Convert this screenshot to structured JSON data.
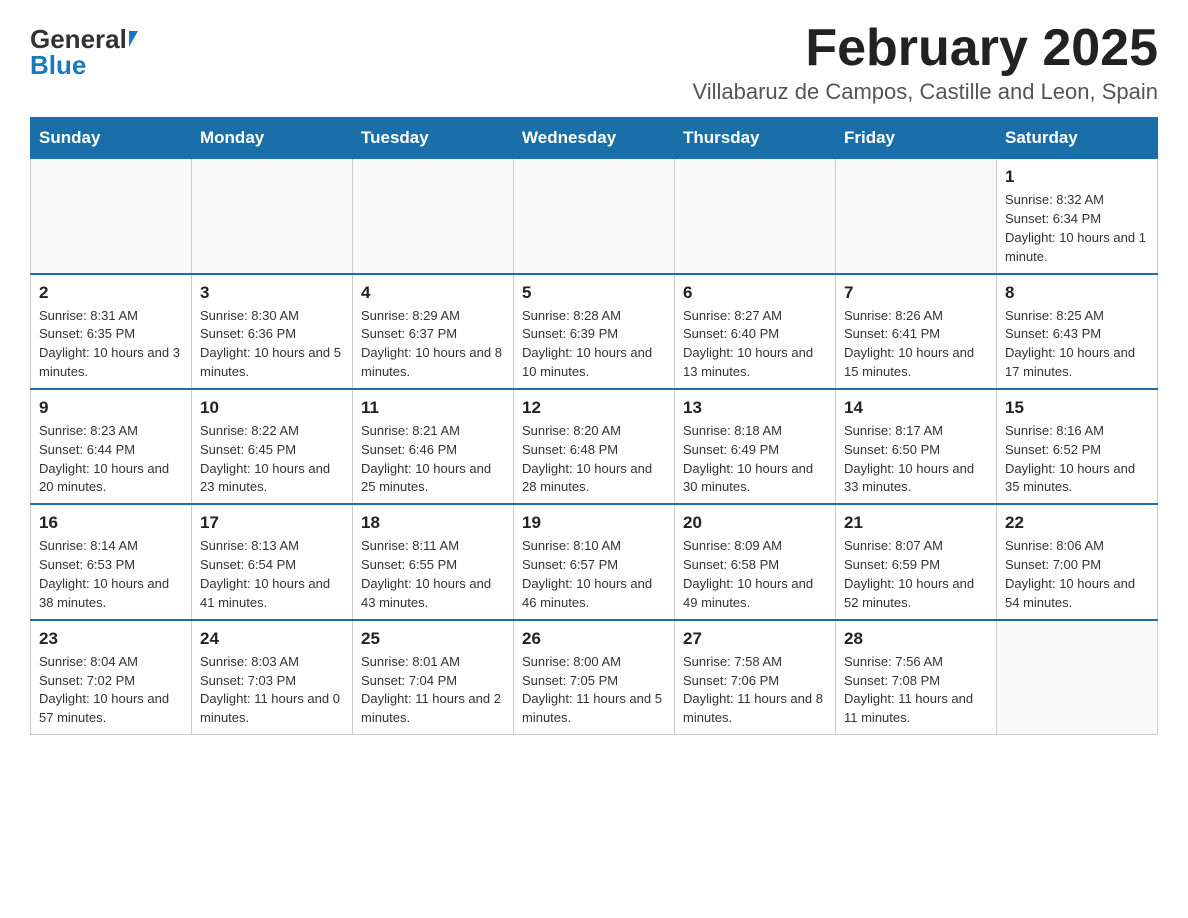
{
  "header": {
    "logo_general": "General",
    "logo_blue": "Blue",
    "month_title": "February 2025",
    "location": "Villabaruz de Campos, Castille and Leon, Spain"
  },
  "days_of_week": [
    "Sunday",
    "Monday",
    "Tuesday",
    "Wednesday",
    "Thursday",
    "Friday",
    "Saturday"
  ],
  "weeks": [
    {
      "days": [
        {
          "num": "",
          "info": ""
        },
        {
          "num": "",
          "info": ""
        },
        {
          "num": "",
          "info": ""
        },
        {
          "num": "",
          "info": ""
        },
        {
          "num": "",
          "info": ""
        },
        {
          "num": "",
          "info": ""
        },
        {
          "num": "1",
          "info": "Sunrise: 8:32 AM\nSunset: 6:34 PM\nDaylight: 10 hours and 1 minute."
        }
      ]
    },
    {
      "days": [
        {
          "num": "2",
          "info": "Sunrise: 8:31 AM\nSunset: 6:35 PM\nDaylight: 10 hours and 3 minutes."
        },
        {
          "num": "3",
          "info": "Sunrise: 8:30 AM\nSunset: 6:36 PM\nDaylight: 10 hours and 5 minutes."
        },
        {
          "num": "4",
          "info": "Sunrise: 8:29 AM\nSunset: 6:37 PM\nDaylight: 10 hours and 8 minutes."
        },
        {
          "num": "5",
          "info": "Sunrise: 8:28 AM\nSunset: 6:39 PM\nDaylight: 10 hours and 10 minutes."
        },
        {
          "num": "6",
          "info": "Sunrise: 8:27 AM\nSunset: 6:40 PM\nDaylight: 10 hours and 13 minutes."
        },
        {
          "num": "7",
          "info": "Sunrise: 8:26 AM\nSunset: 6:41 PM\nDaylight: 10 hours and 15 minutes."
        },
        {
          "num": "8",
          "info": "Sunrise: 8:25 AM\nSunset: 6:43 PM\nDaylight: 10 hours and 17 minutes."
        }
      ]
    },
    {
      "days": [
        {
          "num": "9",
          "info": "Sunrise: 8:23 AM\nSunset: 6:44 PM\nDaylight: 10 hours and 20 minutes."
        },
        {
          "num": "10",
          "info": "Sunrise: 8:22 AM\nSunset: 6:45 PM\nDaylight: 10 hours and 23 minutes."
        },
        {
          "num": "11",
          "info": "Sunrise: 8:21 AM\nSunset: 6:46 PM\nDaylight: 10 hours and 25 minutes."
        },
        {
          "num": "12",
          "info": "Sunrise: 8:20 AM\nSunset: 6:48 PM\nDaylight: 10 hours and 28 minutes."
        },
        {
          "num": "13",
          "info": "Sunrise: 8:18 AM\nSunset: 6:49 PM\nDaylight: 10 hours and 30 minutes."
        },
        {
          "num": "14",
          "info": "Sunrise: 8:17 AM\nSunset: 6:50 PM\nDaylight: 10 hours and 33 minutes."
        },
        {
          "num": "15",
          "info": "Sunrise: 8:16 AM\nSunset: 6:52 PM\nDaylight: 10 hours and 35 minutes."
        }
      ]
    },
    {
      "days": [
        {
          "num": "16",
          "info": "Sunrise: 8:14 AM\nSunset: 6:53 PM\nDaylight: 10 hours and 38 minutes."
        },
        {
          "num": "17",
          "info": "Sunrise: 8:13 AM\nSunset: 6:54 PM\nDaylight: 10 hours and 41 minutes."
        },
        {
          "num": "18",
          "info": "Sunrise: 8:11 AM\nSunset: 6:55 PM\nDaylight: 10 hours and 43 minutes."
        },
        {
          "num": "19",
          "info": "Sunrise: 8:10 AM\nSunset: 6:57 PM\nDaylight: 10 hours and 46 minutes."
        },
        {
          "num": "20",
          "info": "Sunrise: 8:09 AM\nSunset: 6:58 PM\nDaylight: 10 hours and 49 minutes."
        },
        {
          "num": "21",
          "info": "Sunrise: 8:07 AM\nSunset: 6:59 PM\nDaylight: 10 hours and 52 minutes."
        },
        {
          "num": "22",
          "info": "Sunrise: 8:06 AM\nSunset: 7:00 PM\nDaylight: 10 hours and 54 minutes."
        }
      ]
    },
    {
      "days": [
        {
          "num": "23",
          "info": "Sunrise: 8:04 AM\nSunset: 7:02 PM\nDaylight: 10 hours and 57 minutes."
        },
        {
          "num": "24",
          "info": "Sunrise: 8:03 AM\nSunset: 7:03 PM\nDaylight: 11 hours and 0 minutes."
        },
        {
          "num": "25",
          "info": "Sunrise: 8:01 AM\nSunset: 7:04 PM\nDaylight: 11 hours and 2 minutes."
        },
        {
          "num": "26",
          "info": "Sunrise: 8:00 AM\nSunset: 7:05 PM\nDaylight: 11 hours and 5 minutes."
        },
        {
          "num": "27",
          "info": "Sunrise: 7:58 AM\nSunset: 7:06 PM\nDaylight: 11 hours and 8 minutes."
        },
        {
          "num": "28",
          "info": "Sunrise: 7:56 AM\nSunset: 7:08 PM\nDaylight: 11 hours and 11 minutes."
        },
        {
          "num": "",
          "info": ""
        }
      ]
    }
  ]
}
